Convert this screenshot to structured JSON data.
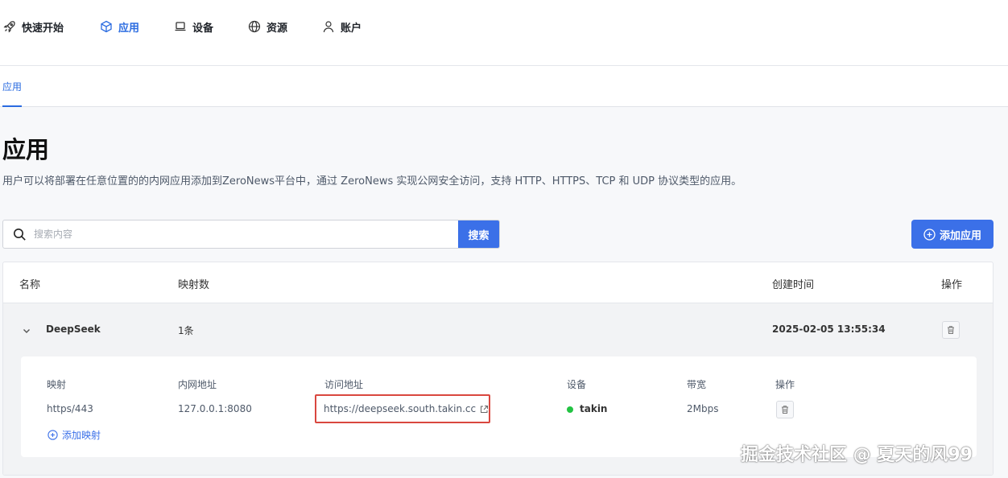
{
  "nav": {
    "items": [
      {
        "label": "快速开始",
        "icon": "rocket-icon"
      },
      {
        "label": "应用",
        "icon": "cube-icon",
        "active": true
      },
      {
        "label": "设备",
        "icon": "laptop-icon"
      },
      {
        "label": "资源",
        "icon": "globe-icon"
      },
      {
        "label": "账户",
        "icon": "user-icon"
      }
    ]
  },
  "subtabs": [
    {
      "label": "应用",
      "active": true
    }
  ],
  "page": {
    "title": "应用",
    "description": "用户可以将部署在任意位置的的内网应用添加到ZeroNews平台中，通过 ZeroNews 实现公网安全访问，支持 HTTP、HTTPS、TCP 和 UDP 协议类型的应用。"
  },
  "search": {
    "placeholder": "搜索内容",
    "value": "",
    "button_label": "搜索"
  },
  "add_app_button": "添加应用",
  "table": {
    "headers": {
      "name": "名称",
      "mappings": "映射数",
      "created": "创建时间",
      "actions": "操作"
    },
    "rows": [
      {
        "name": "DeepSeek",
        "mapping_count": "1条",
        "created": "2025-02-05 13:55:34",
        "expanded": true,
        "detail": {
          "headers": {
            "mapping": "映射",
            "intranet": "内网地址",
            "access": "访问地址",
            "device": "设备",
            "bandwidth": "带宽",
            "actions": "操作"
          },
          "mappings": [
            {
              "mapping": "https/443",
              "intranet": "127.0.0.1:8080",
              "access": "https://deepseek.south.takin.cc",
              "device": "takin",
              "device_status_color": "#23c343",
              "bandwidth": "2Mbps"
            }
          ],
          "add_mapping_label": "添加映射"
        }
      }
    ]
  },
  "watermark": "掘金技术社区 @ 夏天的风99",
  "colors": {
    "accent": "#3b70e8",
    "active_nav": "#2a6be0",
    "highlight_border": "#d9473f",
    "online": "#23c343"
  }
}
